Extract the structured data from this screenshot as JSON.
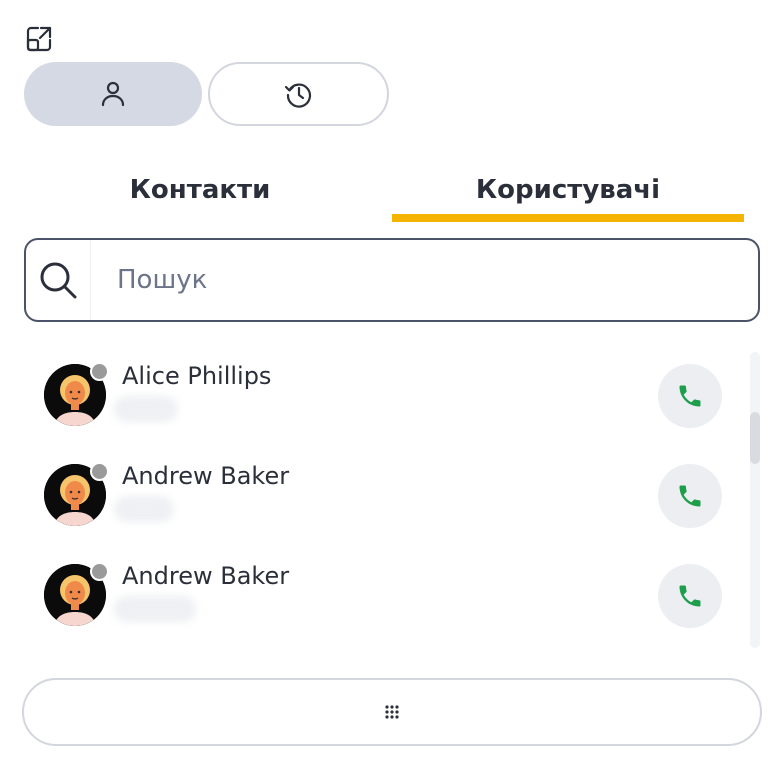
{
  "header": {
    "expand_icon": "expand-window-icon"
  },
  "mode_switch": [
    {
      "name": "contacts-mode",
      "icon": "person-icon",
      "active": true
    },
    {
      "name": "history-mode",
      "icon": "history-icon",
      "active": false
    }
  ],
  "tabs": [
    {
      "label": "Контакти",
      "active": false
    },
    {
      "label": "Користувачі",
      "active": true
    }
  ],
  "search": {
    "placeholder": "Пошук",
    "value": ""
  },
  "contacts": [
    {
      "name": "Alice Phillips",
      "status": "offline",
      "subtitle_blurred": true
    },
    {
      "name": "Andrew Baker",
      "status": "offline",
      "subtitle_blurred": true
    },
    {
      "name": "Andrew Baker",
      "status": "offline",
      "subtitle_blurred": true
    }
  ],
  "call_icon": "phone-icon",
  "dialpad_icon": "dialpad-icon",
  "colors": {
    "accent": "#f4b400",
    "active_mode_bg": "#d5d9e3",
    "call_green": "#1e9e4a",
    "text": "#2b2f3a",
    "status_offline": "#9a9a9a"
  }
}
